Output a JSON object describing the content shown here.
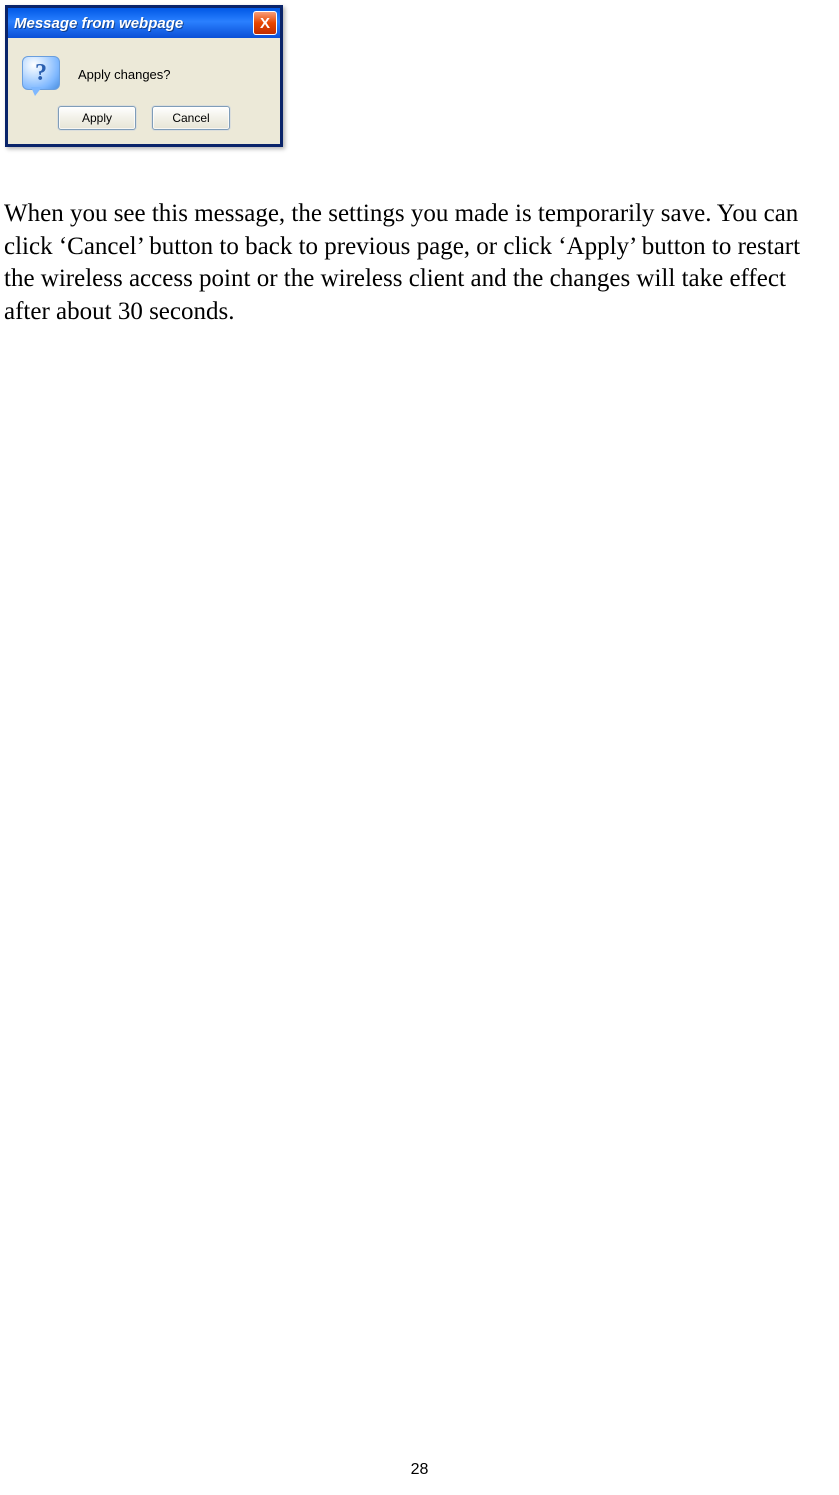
{
  "dialog": {
    "title": "Message from webpage",
    "close_label": "X",
    "help_glyph": "?",
    "message": "Apply changes?",
    "apply_label": "Apply",
    "cancel_label": "Cancel"
  },
  "body_text": "When you see this message, the settings you made is temporarily save. You can click ‘Cancel’ button to back to previous page, or click ‘Apply’ button to restart the wireless access point or the wireless client and the changes will take effect after about 30 seconds.",
  "page_number": "28"
}
